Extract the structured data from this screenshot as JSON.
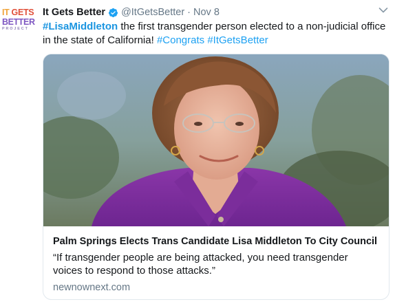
{
  "avatar": {
    "line1a": "IT",
    "line1b": "GETS",
    "line2": "BETTER",
    "line3": "PROJECT"
  },
  "header": {
    "display_name": "It Gets Better",
    "handle": "@ItGetsBetter",
    "separator": "·",
    "time": "Nov 8"
  },
  "tweet": {
    "hashtag_main": "#LisaMiddleton",
    "text_1": " the first transgender person elected to a non-judicial office in the state of California! ",
    "hashtag_1": "#Congrats",
    "hashtag_2": "#ItGetsBetter"
  },
  "card": {
    "title": "Palm Springs Elects Trans Candidate Lisa Middleton To City Council",
    "description": "“If transgender people are being attacked, you need transgender voices to respond to those attacks.”",
    "domain": "newnownext.com"
  },
  "colors": {
    "link": "#1da1f2",
    "verified": "#1da1f2",
    "secondary_text": "#657786"
  }
}
